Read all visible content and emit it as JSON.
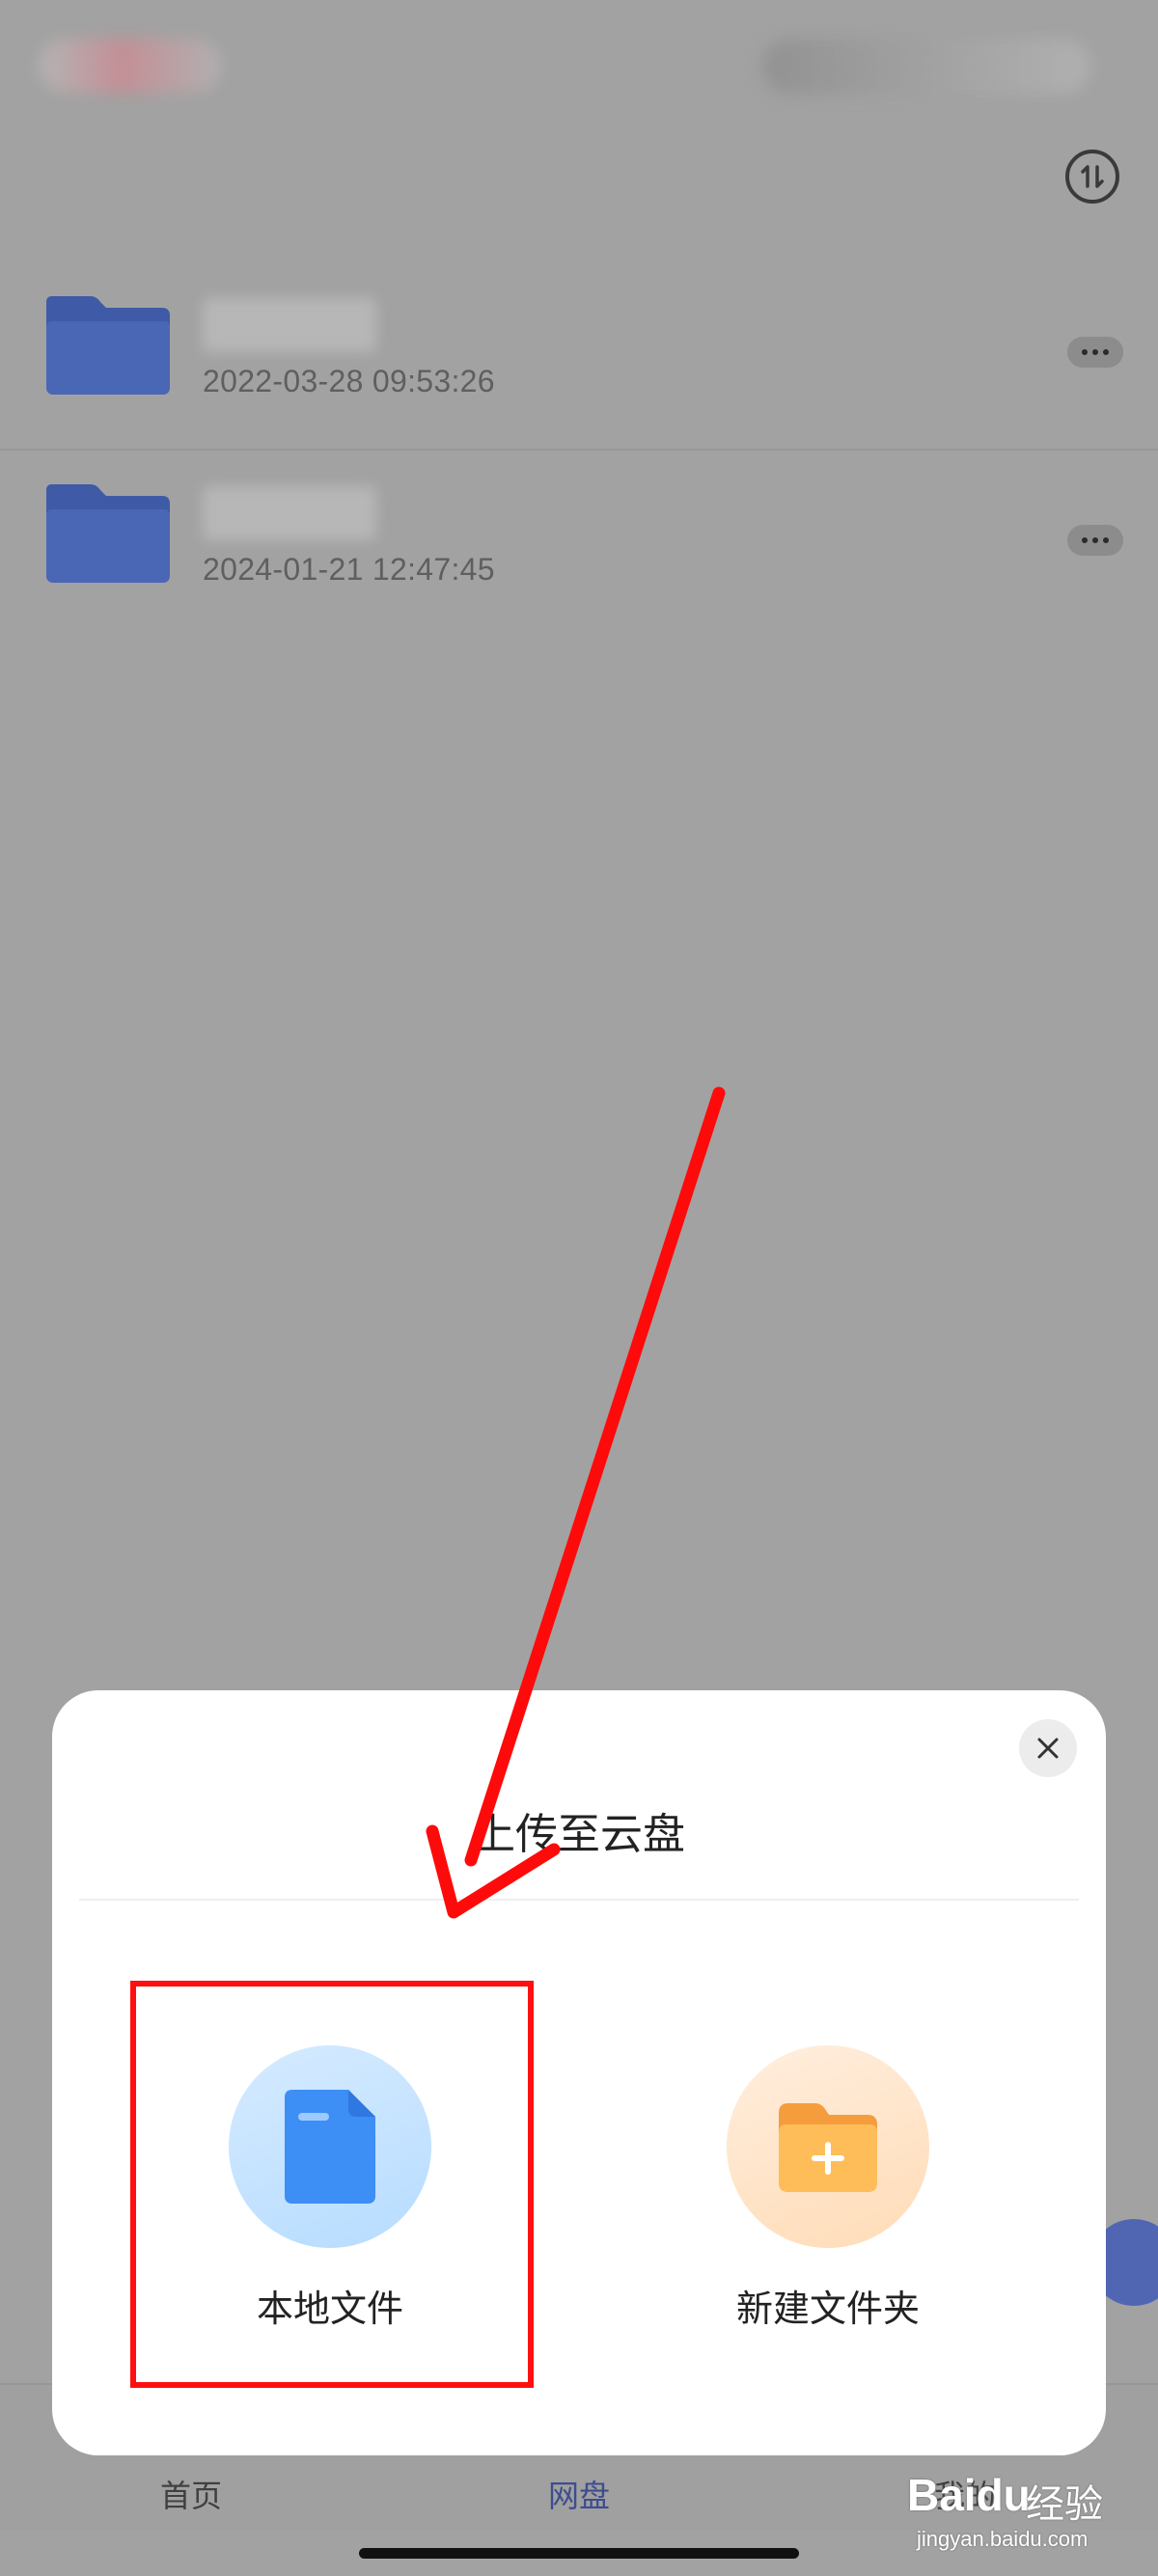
{
  "files": [
    {
      "date": "2022-03-28 09:53:26"
    },
    {
      "date": "2024-01-21 12:47:45"
    }
  ],
  "nav": {
    "home": "首页",
    "disk": "网盘",
    "mine": "我的"
  },
  "sheet": {
    "title": "上传至云盘",
    "options": [
      {
        "label": "本地文件",
        "icon": "document-icon"
      },
      {
        "label": "新建文件夹",
        "icon": "new-folder-icon"
      }
    ]
  },
  "watermark": {
    "brand": "Baidu",
    "jingyan": "经验",
    "url": "jingyan.baidu.com"
  },
  "colors": {
    "overlay_background": "#a2a2a2",
    "annotation_red": "#ff1010",
    "active_tab": "#3e4d8e"
  }
}
